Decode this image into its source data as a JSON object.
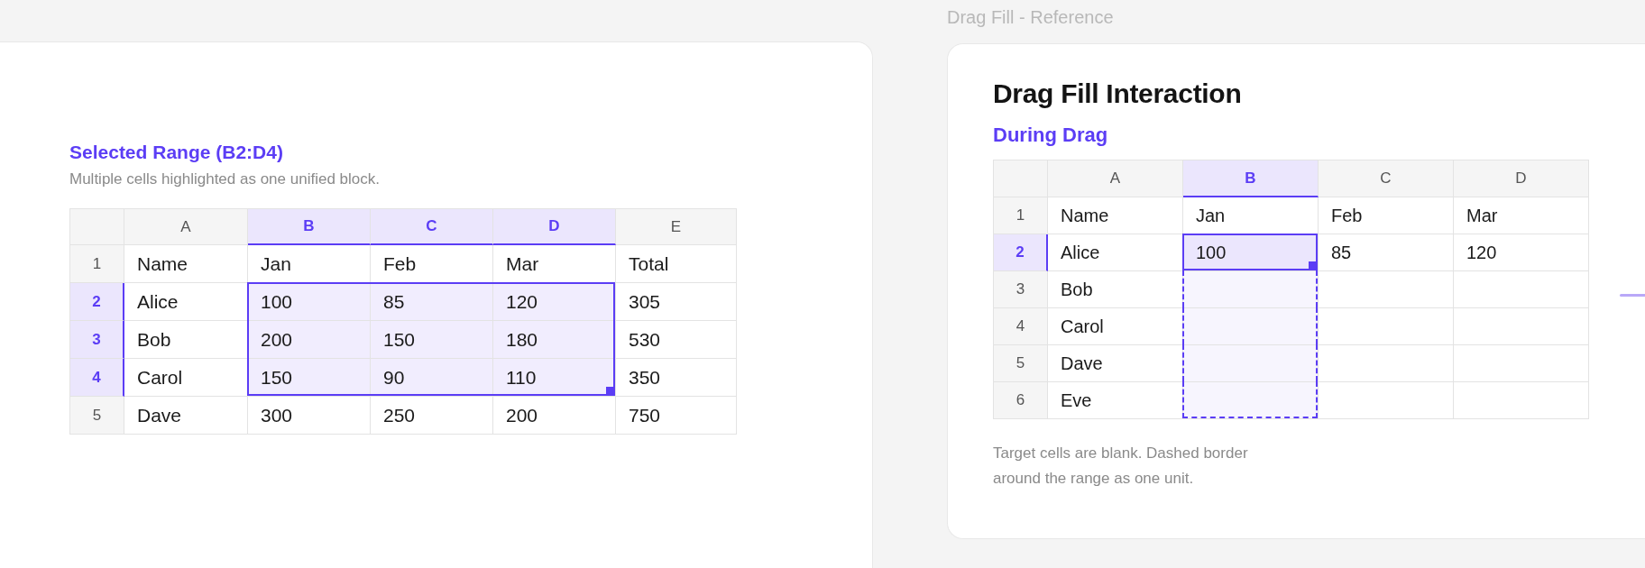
{
  "range_panel": {
    "title": "Selected Range (B2:D4)",
    "description": "Multiple cells highlighted as one unified block.",
    "table": {
      "columns": [
        {
          "label": "A",
          "selected": false
        },
        {
          "label": "B",
          "selected": true
        },
        {
          "label": "C",
          "selected": true
        },
        {
          "label": "D",
          "selected": true
        },
        {
          "label": "E",
          "selected": false
        }
      ],
      "rows": [
        {
          "label": "1",
          "selected": false,
          "cells": [
            {
              "text": "Name",
              "selected": false
            },
            {
              "text": "Jan",
              "selected": false
            },
            {
              "text": "Feb",
              "selected": false
            },
            {
              "text": "Mar",
              "selected": false
            },
            {
              "text": "Total",
              "selected": false
            }
          ]
        },
        {
          "label": "2",
          "selected": true,
          "cells": [
            {
              "text": "Alice",
              "selected": false
            },
            {
              "text": "100",
              "selected": true
            },
            {
              "text": "85",
              "selected": true
            },
            {
              "text": "120",
              "selected": true
            },
            {
              "text": "305",
              "selected": false
            }
          ]
        },
        {
          "label": "3",
          "selected": true,
          "cells": [
            {
              "text": "Bob",
              "selected": false
            },
            {
              "text": "200",
              "selected": true
            },
            {
              "text": "150",
              "selected": true
            },
            {
              "text": "180",
              "selected": true
            },
            {
              "text": "530",
              "selected": false
            }
          ]
        },
        {
          "label": "4",
          "selected": true,
          "cells": [
            {
              "text": "Carol",
              "selected": false
            },
            {
              "text": "150",
              "selected": true
            },
            {
              "text": "90",
              "selected": true
            },
            {
              "text": "110",
              "selected": true
            },
            {
              "text": "350",
              "selected": false
            }
          ]
        },
        {
          "label": "5",
          "selected": false,
          "cells": [
            {
              "text": "Dave",
              "selected": false
            },
            {
              "text": "300",
              "selected": false
            },
            {
              "text": "250",
              "selected": false
            },
            {
              "text": "200",
              "selected": false
            },
            {
              "text": "750",
              "selected": false
            }
          ]
        }
      ]
    }
  },
  "reference": {
    "label": "Drag Fill - Reference",
    "title": "Drag Fill Interaction",
    "subtitle": "During Drag",
    "table": {
      "columns": [
        {
          "label": "A",
          "selected": false
        },
        {
          "label": "B",
          "selected": true
        },
        {
          "label": "C",
          "selected": false
        },
        {
          "label": "D",
          "selected": false
        }
      ],
      "rows": [
        {
          "label": "1",
          "selected": false,
          "cells": [
            {
              "text": "Name",
              "kind": "normal"
            },
            {
              "text": "Jan",
              "kind": "normal"
            },
            {
              "text": "Feb",
              "kind": "normal"
            },
            {
              "text": "Mar",
              "kind": "normal"
            }
          ]
        },
        {
          "label": "2",
          "selected": true,
          "cells": [
            {
              "text": "Alice",
              "kind": "normal"
            },
            {
              "text": "100",
              "kind": "active"
            },
            {
              "text": "85",
              "kind": "normal"
            },
            {
              "text": "120",
              "kind": "normal"
            }
          ]
        },
        {
          "label": "3",
          "selected": false,
          "cells": [
            {
              "text": "Bob",
              "kind": "normal"
            },
            {
              "kind": "fill"
            },
            {
              "kind": "normal"
            },
            {
              "kind": "normal"
            }
          ]
        },
        {
          "label": "4",
          "selected": false,
          "cells": [
            {
              "text": "Carol",
              "kind": "normal"
            },
            {
              "kind": "fill"
            },
            {
              "kind": "normal"
            },
            {
              "kind": "normal"
            }
          ]
        },
        {
          "label": "5",
          "selected": false,
          "cells": [
            {
              "text": "Dave",
              "kind": "normal"
            },
            {
              "kind": "fill"
            },
            {
              "kind": "normal"
            },
            {
              "kind": "normal"
            }
          ]
        },
        {
          "label": "6",
          "selected": false,
          "cells": [
            {
              "text": "Eve",
              "kind": "normal"
            },
            {
              "kind": "fill"
            },
            {
              "kind": "normal"
            },
            {
              "kind": "normal"
            }
          ]
        }
      ]
    },
    "note": "Target cells are blank. Dashed border around the range as one unit."
  }
}
